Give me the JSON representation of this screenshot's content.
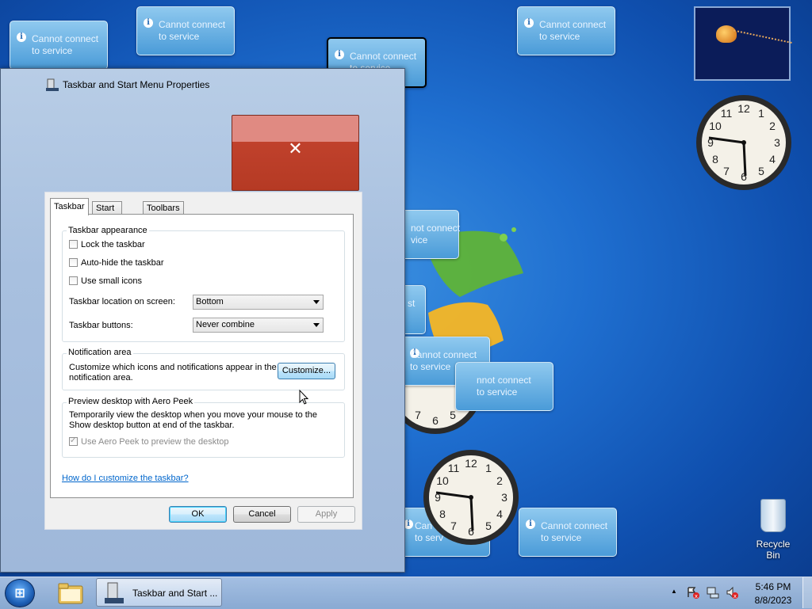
{
  "gadgets": {
    "cannot_connect": [
      {
        "line1": "Cannot connect",
        "line2": "to service"
      },
      {
        "line1": "Cannot connect",
        "line2": "to service"
      },
      {
        "line1": "Cannot connect",
        "line2": "to service"
      },
      {
        "line1": "Cannot connect",
        "line2": "to service"
      },
      {
        "line1": "not connect",
        "line2": "vice"
      },
      {
        "line1": "st",
        "line2": ""
      },
      {
        "line1": "Cannot connect",
        "line2": "to service"
      },
      {
        "line1": "nnot connect",
        "line2": "to service"
      },
      {
        "line1": "Can",
        "line2": "to serv"
      },
      {
        "line1": "Cannot connect",
        "line2": "to service"
      }
    ],
    "clock_numbers": [
      "12",
      "1",
      "2",
      "3",
      "4",
      "5",
      "6",
      "7",
      "8",
      "9",
      "10",
      "11"
    ]
  },
  "window": {
    "title": "Taskbar and Start Menu Properties",
    "close_glyph": "✕",
    "tabs": [
      "Taskbar",
      "Start Menu",
      "Toolbars"
    ],
    "appearance": {
      "title": "Taskbar appearance",
      "lock_label": "Lock the taskbar",
      "autohide_label": "Auto-hide the taskbar",
      "small_icons_label": "Use small icons",
      "location_label": "Taskbar location on screen:",
      "location_value": "Bottom",
      "buttons_label": "Taskbar buttons:",
      "buttons_value": "Never combine"
    },
    "notification": {
      "title": "Notification area",
      "text_line1": "Customize which icons and notifications appear in the",
      "text_line2": "notification area.",
      "customize_label": "Customize..."
    },
    "peek": {
      "title": "Preview desktop with Aero Peek",
      "text_line1": "Temporarily view the desktop when you move your mouse to the",
      "text_line2": "Show desktop button at end of the taskbar.",
      "checkbox_label": "Use Aero Peek to preview the desktop"
    },
    "help_link": "How do I customize the taskbar?",
    "ok_label": "OK",
    "cancel_label": "Cancel",
    "apply_label": "Apply"
  },
  "desktop": {
    "recycle_bin_label": "Recycle Bin"
  },
  "taskbar": {
    "start_glyph": "⊞",
    "task_label": "Taskbar and Start ...",
    "time": "5:46 PM",
    "date": "8/8/2023",
    "tray_up_glyph": "▲",
    "icons": [
      "action-center-icon",
      "network-icon",
      "volume-muted-icon"
    ]
  },
  "colors": {
    "close_red": "#c0412c",
    "link_blue": "#0066cc",
    "gadget_blue": "#4a9bd8"
  }
}
